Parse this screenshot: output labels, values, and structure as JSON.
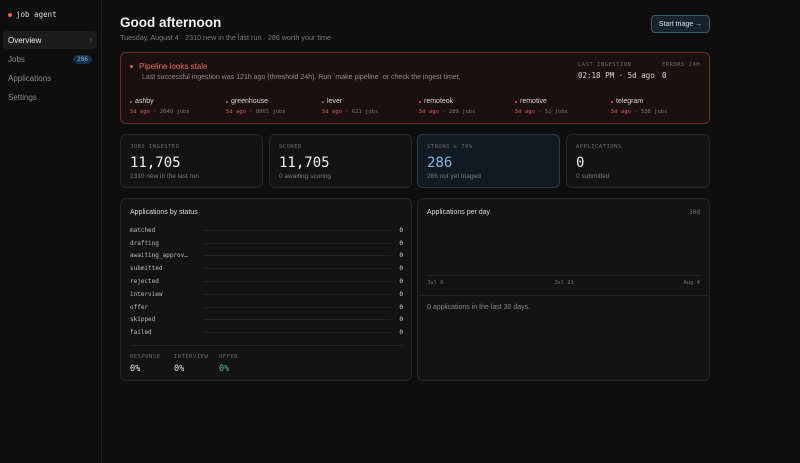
{
  "app": {
    "name": "job agent"
  },
  "sidebar": {
    "items": [
      {
        "label": "Overview",
        "chev": "›"
      },
      {
        "label": "Jobs",
        "badge": "286"
      },
      {
        "label": "Applications"
      },
      {
        "label": "Settings"
      }
    ]
  },
  "header": {
    "title": "Good afternoon",
    "subtitle": "Tuesday, August 4 · 2310 new in the last run · 286 worth your time",
    "triage_label": "Start triage →"
  },
  "alert": {
    "title": "Pipeline looks stale",
    "message": "Last successful ingestion was 121h ago (threshold 24h). Run `make pipeline` or check the ingest timer.",
    "last_ingestion_label": "LAST INGESTION",
    "last_ingestion_value": "02:18 PM · 5d ago",
    "errors_label": "ERRORS 24H",
    "errors_value": "0",
    "sources": [
      {
        "name": "ashby",
        "ago": "5d ago",
        "jobs": "2040 jobs"
      },
      {
        "name": "greenhouse",
        "ago": "5d ago",
        "jobs": "8065 jobs"
      },
      {
        "name": "lever",
        "ago": "5d ago",
        "jobs": "621 jobs"
      },
      {
        "name": "remoteok",
        "ago": "5d ago",
        "jobs": "289 jobs"
      },
      {
        "name": "remotive",
        "ago": "5d ago",
        "jobs": "52 jobs"
      },
      {
        "name": "telegram",
        "ago": "5d ago",
        "jobs": "538 jobs"
      }
    ]
  },
  "stats": [
    {
      "label": "JOBS INGESTED",
      "value": "11,705",
      "sub": "2310 new in the last run"
    },
    {
      "label": "SCORED",
      "value": "11,705",
      "sub": "0 awaiting scoring"
    },
    {
      "label": "STRONG ≥ 70%",
      "value": "286",
      "sub": "286 not yet triaged"
    },
    {
      "label": "APPLICATIONS",
      "value": "0",
      "sub": "0 submitted"
    }
  ],
  "status_panel": {
    "title": "Applications by status",
    "rows": [
      {
        "label": "matched",
        "count": "0"
      },
      {
        "label": "drafting",
        "count": "0"
      },
      {
        "label": "awaiting_approv…",
        "count": "0"
      },
      {
        "label": "submitted",
        "count": "0"
      },
      {
        "label": "rejected",
        "count": "0"
      },
      {
        "label": "interview",
        "count": "0"
      },
      {
        "label": "offer",
        "count": "0"
      },
      {
        "label": "skipped",
        "count": "0"
      },
      {
        "label": "failed",
        "count": "0"
      }
    ],
    "rates": [
      {
        "label": "RESPONSE",
        "value": "0%"
      },
      {
        "label": "INTERVIEW",
        "value": "0%"
      },
      {
        "label": "OFFER",
        "value": "0%"
      }
    ]
  },
  "per_day_panel": {
    "title": "Applications per day",
    "range": "30d",
    "ticks": [
      "Jul 6",
      "Jul 21",
      "Aug 4"
    ],
    "empty_text": "0 applications in the last 30 days."
  }
}
